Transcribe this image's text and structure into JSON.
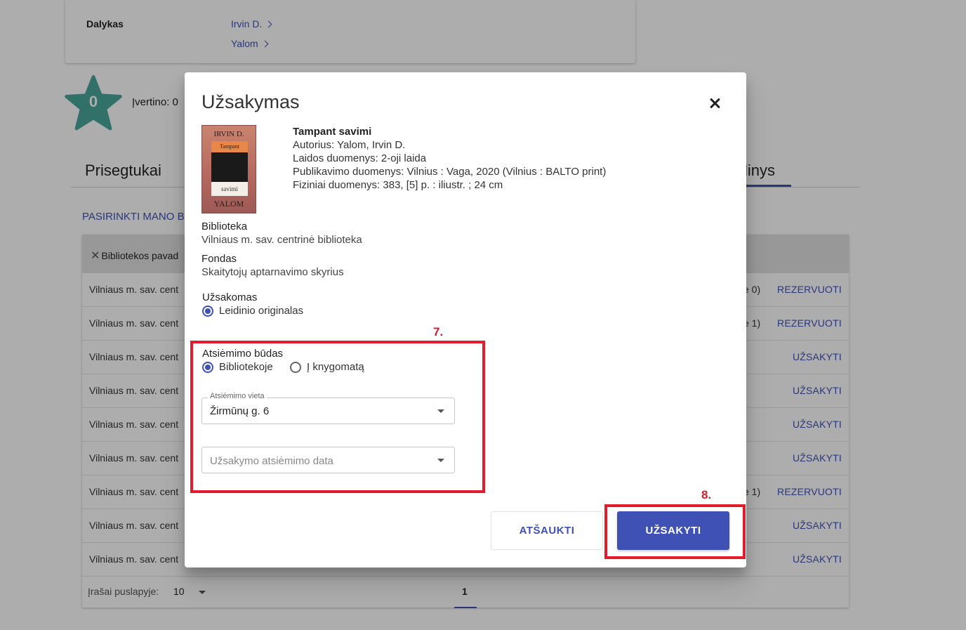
{
  "background": {
    "subject_label": "Dalykas",
    "authors": [
      "Irvin D.",
      "Yalom"
    ],
    "rating_value": "0",
    "rating_text": "Įvertino: 0",
    "tab_left": "Prisegtukai",
    "tab_right": "linys",
    "choose_link": "PASIRINKTI MANO B",
    "table_header": "Bibliotekos pavad",
    "rows": [
      {
        "library": "Vilniaus m. sav. cent",
        "count": "e 0)",
        "action": "REZERVUOTI"
      },
      {
        "library": "Vilniaus m. sav. cent",
        "count": "e 1)",
        "action": "REZERVUOTI"
      },
      {
        "library": "Vilniaus m. sav. cent",
        "count": "",
        "action": "UŽSAKYTI"
      },
      {
        "library": "Vilniaus m. sav. cent",
        "count": "",
        "action": "UŽSAKYTI"
      },
      {
        "library": "Vilniaus m. sav. cent",
        "count": "",
        "action": "UŽSAKYTI"
      },
      {
        "library": "Vilniaus m. sav. cent",
        "count": "",
        "action": "UŽSAKYTI"
      },
      {
        "library": "Vilniaus m. sav. cent",
        "count": "e 1)",
        "action": "REZERVUOTI"
      },
      {
        "library": "Vilniaus m. sav. cent",
        "count": "",
        "action": "UŽSAKYTI"
      },
      {
        "library": "Vilniaus m. sav. cent",
        "count": "",
        "action": "UŽSAKYTI"
      }
    ],
    "per_page_label": "Įrašai puslapyje:",
    "per_page_value": "10",
    "current_page": "1"
  },
  "dialog": {
    "title": "Užsakymas",
    "cover": {
      "author": "IRVIN D.",
      "title_top": "Tampant",
      "title_bottom": "savimi",
      "name": "YALOM"
    },
    "book": {
      "title": "Tampant savimi",
      "author": "Autorius: Yalom, Irvin D.",
      "edition": "Laidos duomenys: 2-oji laida",
      "publication": "Publikavimo duomenys: Vilnius : Vaga, 2020 (Vilnius : BALTO print)",
      "physical": "Fiziniai duomenys: 383, [5] p. : iliustr. ; 24 cm"
    },
    "library_label": "Biblioteka",
    "library_value": "Vilniaus m. sav. centrinė biblioteka",
    "fund_label": "Fondas",
    "fund_value": "Skaitytojų aptarnavimo skyrius",
    "ordering_label": "Užsakomas",
    "ordering_option": "Leidinio originalas",
    "pickup_method_label": "Atsiėmimo būdas",
    "pickup_options": [
      "Bibliotekoje",
      "Į knygomatą"
    ],
    "pickup_place_label": "Atsiėmimo vieta",
    "pickup_place_value": "Žirmūnų g. 6",
    "pickup_date_placeholder": "Užsakymo atsiėmimo data",
    "cancel_label": "ATŠAUKTI",
    "submit_label": "UŽSAKYTI"
  },
  "annotations": {
    "step7": "7.",
    "step8": "8."
  },
  "colors": {
    "accent": "#3f51b5",
    "annotation": "#e21c2c",
    "star": "#4aa79c"
  }
}
